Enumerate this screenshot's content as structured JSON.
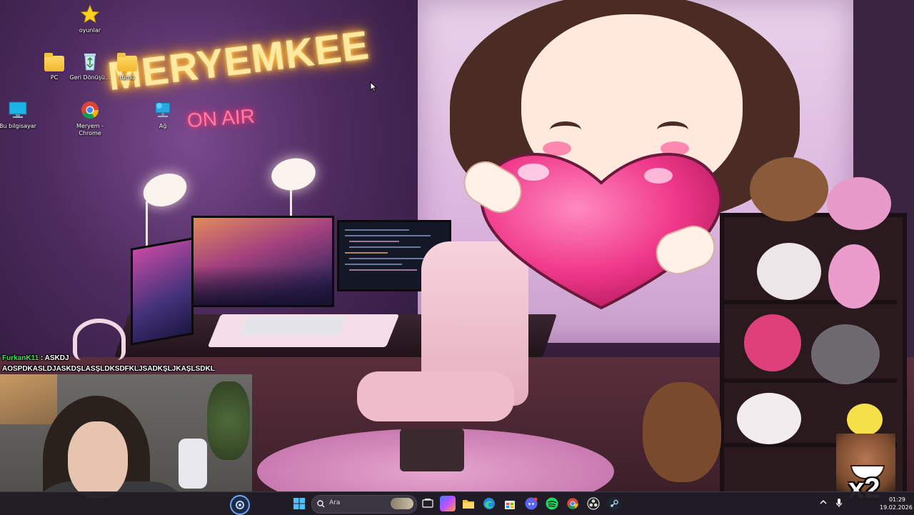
{
  "desktop": {
    "icons": [
      {
        "label": "oyunlar",
        "icon": "star-icon"
      },
      {
        "label": "PC",
        "icon": "folder-icon"
      },
      {
        "label": "Geri Dönüşü...",
        "icon": "recycle-bin-icon"
      },
      {
        "label": "tümü",
        "icon": "folder-icon"
      },
      {
        "label": "Bu bilgisayar",
        "icon": "monitor-icon"
      },
      {
        "label": "Meryem - Chrome",
        "icon": "chrome-icon"
      },
      {
        "label": "Ağ",
        "icon": "network-icon"
      }
    ]
  },
  "wallpaper": {
    "neon_title": "MERYEMKEE",
    "neon_subtitle": "ON AIR"
  },
  "chat": {
    "username": "FurkanK11",
    "separator": " : ",
    "message_line1": "ASKDJ",
    "message_line2": "AOSPDKASLDJASKDŞLASŞLDKSDFKLJSADKŞLJKAŞLSDKL"
  },
  "overlay": {
    "multiplier": "x2"
  },
  "taskbar": {
    "search_placeholder": "Ara",
    "pinned": [
      "start-icon",
      "search-icon",
      "task-view-icon",
      "copilot-icon",
      "file-explorer-icon",
      "edge-icon",
      "store-icon",
      "discord-icon",
      "spotify-icon",
      "chrome-icon",
      "obs-icon",
      "steam-icon"
    ],
    "clock_time": "01:29",
    "clock_date": "19.02.2026"
  },
  "colors": {
    "neon_yellow": "#ffe9a0",
    "neon_pink": "#ff7aa0",
    "chat_username": "#3ee35a",
    "taskbar_bg": "#201c24"
  }
}
